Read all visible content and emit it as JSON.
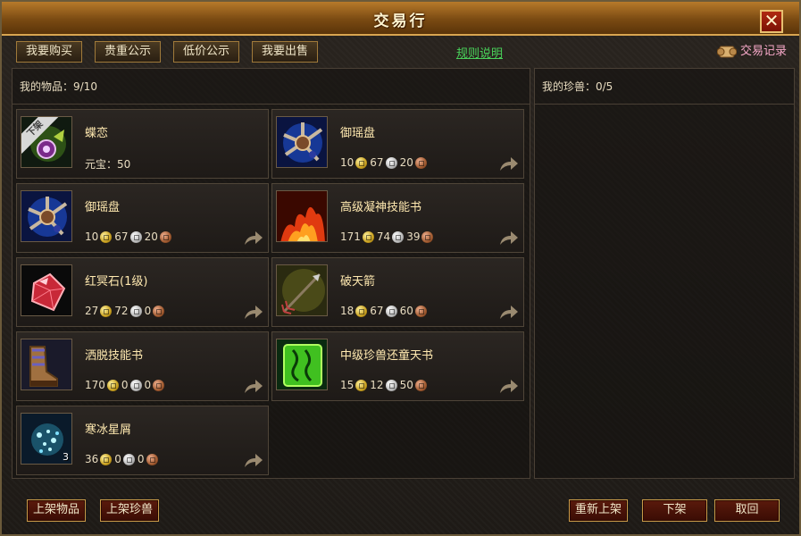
{
  "window": {
    "title": "交易行",
    "close_label": "✕"
  },
  "tabs": [
    {
      "label": "我要购买"
    },
    {
      "label": "贵重公示"
    },
    {
      "label": "低价公示"
    },
    {
      "label": "我要出售"
    }
  ],
  "rules_link": "规则说明",
  "trade_record": "交易记录",
  "my_items": {
    "label": "我的物品：9/10"
  },
  "my_pets": {
    "label": "我的珍兽：0/5"
  },
  "items": [
    {
      "name": "蝶恋",
      "price_text": "元宝：50",
      "icon": "butterfly-gem-icon",
      "tag": "下架"
    },
    {
      "name": "御瑶盘",
      "gold": "10",
      "silver": "67",
      "copper": "20",
      "icon": "jade-disc-icon"
    },
    {
      "name": "御瑶盘",
      "gold": "10",
      "silver": "67",
      "copper": "20",
      "icon": "jade-disc-icon"
    },
    {
      "name": "高级凝神技能书",
      "gold": "171",
      "silver": "74",
      "copper": "39",
      "icon": "fire-skillbook-icon"
    },
    {
      "name": "红冥石(1级)",
      "gold": "27",
      "silver": "72",
      "copper": "0",
      "icon": "red-gem-icon"
    },
    {
      "name": "破天箭",
      "gold": "18",
      "silver": "67",
      "copper": "60",
      "icon": "arrow-icon"
    },
    {
      "name": "洒脱技能书",
      "gold": "170",
      "silver": "0",
      "copper": "0",
      "icon": "boot-skillbook-icon"
    },
    {
      "name": "中级珍兽还童天书",
      "gold": "15",
      "silver": "12",
      "copper": "50",
      "icon": "green-scroll-icon"
    },
    {
      "name": "寒冰星屑",
      "gold": "36",
      "silver": "0",
      "copper": "0",
      "icon": "ice-star-icon",
      "qty": "3"
    }
  ],
  "buttons": {
    "list_item": "上架物品",
    "list_pet": "上架珍兽",
    "relist": "重新上架",
    "delist": "下架",
    "cancel": "取回"
  }
}
